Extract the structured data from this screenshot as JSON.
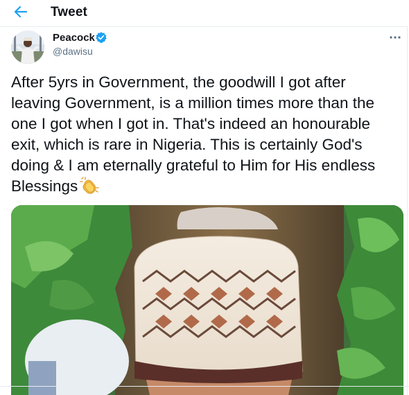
{
  "header": {
    "title": "Tweet",
    "back_icon": "arrow-left-icon"
  },
  "tweet": {
    "author": {
      "display_name": "Peacock",
      "handle": "@dawisu",
      "verified": true
    },
    "text": "After 5yrs in Government, the goodwill I got after leaving Government, is a million times more than the one I got when I got in. That's indeed an honourable exit, which is rare in Nigeria. This is certainly God's doing & I am eternally grateful to Him for His endless Blessings",
    "emoji": "clapping-hands-icon",
    "more_icon": "more-options-icon"
  },
  "colors": {
    "accent": "#1da1f2",
    "text": "#0f1419",
    "secondary_text": "#5b7083",
    "border": "#e6ecf0"
  }
}
